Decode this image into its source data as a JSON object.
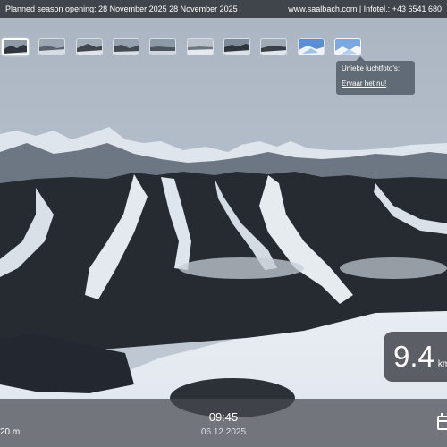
{
  "top_bar": {
    "season_opening": "Planned season opening: 28 November 2025 28 November 2025",
    "contact": "www.saalbach.com | Infotel.: +43 6541 680"
  },
  "thumbnails": {
    "count": 10,
    "active_index": 0
  },
  "tooltip": {
    "title": "Unieke luchtfoto's:",
    "link": "Ervaar het nu!"
  },
  "distance": {
    "value": "9.4",
    "unit": "km"
  },
  "bottom_bar": {
    "altitude": "20 m",
    "time": "09:45",
    "date": "06.12.2025"
  },
  "icons": {
    "calendar": "calendar-icon"
  }
}
